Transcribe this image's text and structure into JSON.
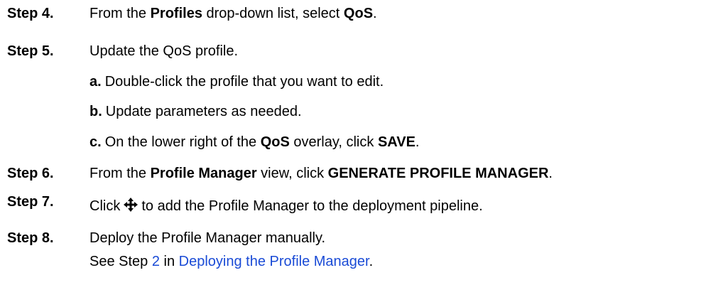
{
  "steps": [
    {
      "label": "Step 4.",
      "parts": [
        "From the ",
        "Profiles",
        " drop-down list, select ",
        "QoS",
        "."
      ]
    },
    {
      "label": "Step 5.",
      "text": "Update the QoS profile.",
      "substeps": [
        {
          "label": "a.",
          "parts": [
            "Double-click the profile that you want to edit."
          ]
        },
        {
          "label": "b.",
          "parts": [
            "Update parameters as needed."
          ]
        },
        {
          "label": "c.",
          "parts": [
            "On the lower right of the ",
            "QoS",
            " overlay, click ",
            "SAVE",
            "."
          ]
        }
      ]
    },
    {
      "label": "Step 6.",
      "parts": [
        "From the ",
        "Profile Manager",
        " view, click ",
        "GENERATE PROFILE MANAGER",
        "."
      ]
    },
    {
      "label": "Step 7.",
      "before_icon": "Click",
      "icon": "move-arrows-icon",
      "after_icon": "to add the Profile Manager to the deployment pipeline."
    },
    {
      "label": "Step 8.",
      "text": "Deploy the Profile Manager manually.",
      "continuation": {
        "prefix": "See Step ",
        "link_step": "2",
        "middle": " in ",
        "link_title": "Deploying the Profile Manager",
        "suffix": "."
      }
    }
  ],
  "colors": {
    "text": "#000000",
    "link": "#1a4bd6"
  }
}
